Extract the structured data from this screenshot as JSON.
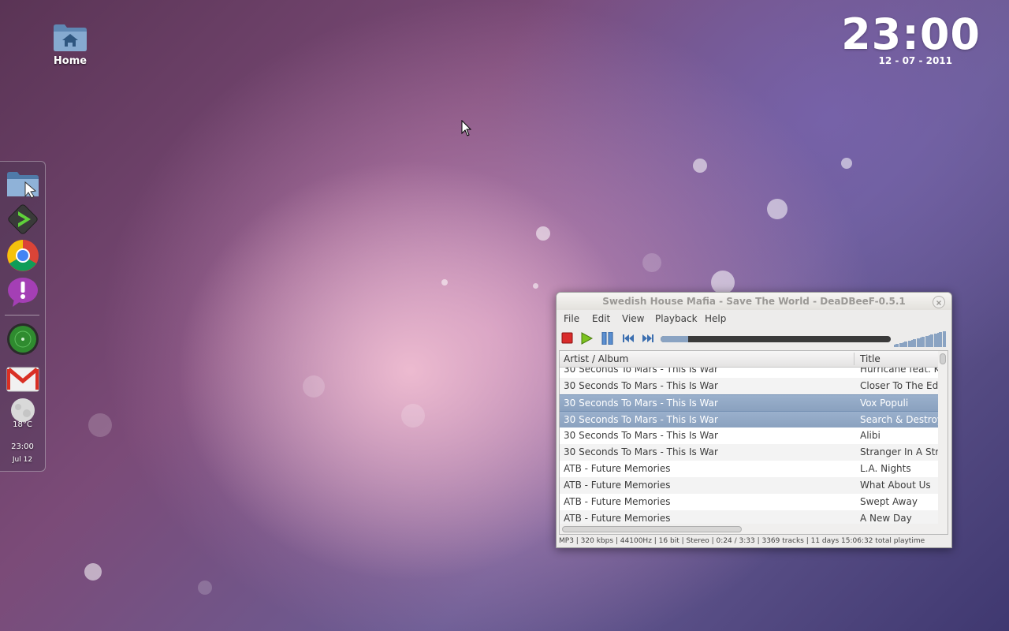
{
  "desktop": {
    "home_label": "Home"
  },
  "clock": {
    "time": "23:00",
    "date": "12 - 07 - 2011"
  },
  "dock": {
    "items": [
      {
        "name": "file-manager-icon"
      },
      {
        "name": "media-player-icon"
      },
      {
        "name": "chrome-icon"
      },
      {
        "name": "notification-icon"
      },
      {
        "name": "radar-icon"
      },
      {
        "name": "gmail-icon"
      },
      {
        "name": "weather-moon-icon"
      }
    ],
    "weather_temp": "18°C",
    "time": "23:00",
    "date": "Jul 12"
  },
  "player": {
    "title": "Swedish House Mafia - Save The World - DeaDBeeF-0.5.1",
    "menu": [
      "File",
      "Edit",
      "View",
      "Playback",
      "Help"
    ],
    "progress": 0.12,
    "columns": [
      "Artist / Album",
      "Title"
    ],
    "rows": [
      {
        "artist": "30 Seconds To Mars - This Is War",
        "title": "Hurricane feat. Ka",
        "selected": false
      },
      {
        "artist": "30 Seconds To Mars - This Is War",
        "title": "Closer To The Edge",
        "selected": false
      },
      {
        "artist": "30 Seconds To Mars - This Is War",
        "title": "Vox Populi",
        "selected": true
      },
      {
        "artist": "30 Seconds To Mars - This Is War",
        "title": "Search & Destroy",
        "selected": true
      },
      {
        "artist": "30 Seconds To Mars - This Is War",
        "title": "Alibi",
        "selected": false
      },
      {
        "artist": "30 Seconds To Mars - This Is War",
        "title": "Stranger In A Stran",
        "selected": false
      },
      {
        "artist": "ATB - Future Memories",
        "title": "L.A. Nights",
        "selected": false
      },
      {
        "artist": "ATB - Future Memories",
        "title": "What About Us",
        "selected": false
      },
      {
        "artist": "ATB - Future Memories",
        "title": "Swept Away",
        "selected": false
      },
      {
        "artist": "ATB - Future Memories",
        "title": "A New Day",
        "selected": false
      }
    ],
    "status": "MP3 |  320 kbps | 44100Hz | 16 bit | Stereo | 0:24 / 3:33 | 3369 tracks | 11 days 15:06:32 total playtime"
  }
}
